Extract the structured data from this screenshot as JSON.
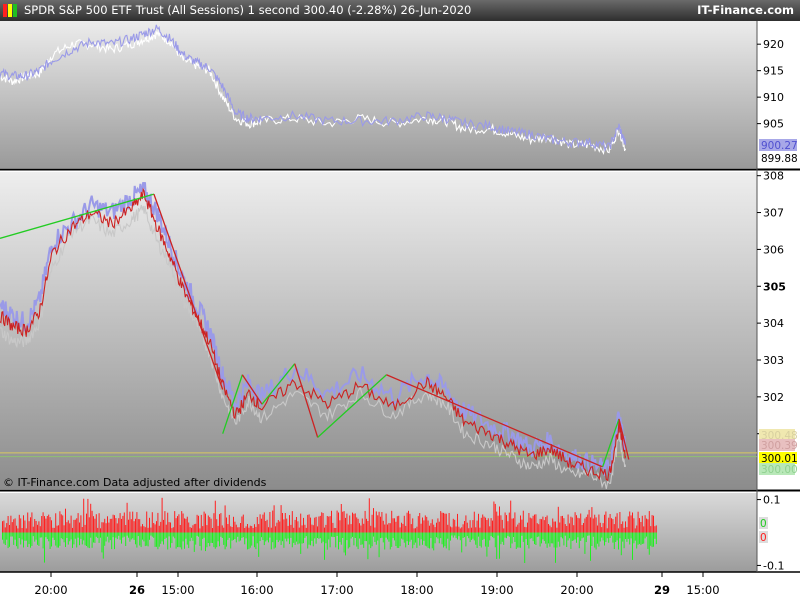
{
  "header": {
    "title": "SPDR S&P 500 ETF Trust (All Sessions)   1 second   300.40 (-2.28%)   26-Jun-2020",
    "brand": "IT-Finance.com",
    "logo_colors": [
      "#ff2020",
      "#ffff00",
      "#20c020"
    ]
  },
  "chart_data": [
    {
      "type": "line",
      "panel": "top",
      "y_ticks": [
        "920",
        "915",
        "910",
        "905"
      ],
      "ylim": [
        897,
        924
      ],
      "series": [
        {
          "color": "#ffffff",
          "x": [
            19.5,
            19.7,
            19.9,
            20.1,
            20.3,
            20.6,
            20.9,
            21.2,
            21.5,
            21.7,
            21.9,
            22.1,
            22.3,
            22.5,
            22.7,
            22.9,
            23.1,
            23.3,
            23.5,
            24.0,
            24.5,
            25.0,
            25.5,
            26.0,
            26.3,
            26.6,
            27.0,
            27.3,
            27.6,
            27.9,
            28.2,
            28.5,
            28.8,
            28.95,
            29.05
          ],
          "y": [
            914,
            913,
            914,
            914.5,
            918,
            920,
            920,
            919,
            920,
            921,
            922,
            920.5,
            917,
            916,
            915,
            910,
            906,
            905,
            905.5,
            906,
            905,
            906,
            905,
            906,
            905.5,
            904,
            904,
            903,
            902,
            902.5,
            901,
            901,
            900,
            904,
            900
          ]
        },
        {
          "color": "#9a9ae8",
          "x": [
            19.5,
            19.7,
            19.9,
            20.1,
            20.3,
            20.6,
            20.9,
            21.2,
            21.5,
            21.7,
            21.9,
            22.1,
            22.3,
            22.5,
            22.7,
            22.9,
            23.1,
            23.3,
            23.5,
            24.0,
            24.5,
            25.0,
            25.5,
            26.0,
            26.3,
            26.6,
            27.0,
            27.3,
            27.6,
            27.9,
            28.2,
            28.5,
            28.8,
            28.95,
            29.05
          ],
          "y": [
            914.5,
            914,
            914,
            915,
            917,
            919,
            920.5,
            920,
            921,
            922,
            923,
            921,
            918,
            916.5,
            915.5,
            912,
            907,
            906,
            906,
            906.5,
            905.5,
            905.5,
            905.5,
            906.5,
            906,
            905,
            904.5,
            903.5,
            903,
            902,
            901.5,
            901.5,
            900.5,
            904.5,
            901
          ]
        }
      ],
      "price_flags": [
        {
          "value": "900.27",
          "bg": "#a8a8e8",
          "fg": "#5050d0"
        },
        {
          "value": "899.88",
          "bg": "#ffffff",
          "fg": "#000000"
        }
      ]
    },
    {
      "type": "line",
      "panel": "main",
      "y_ticks": [
        "308",
        "307",
        "306",
        "305",
        "304",
        "303",
        "302",
        "301"
      ],
      "bold_tick": "305",
      "ylim": [
        299.5,
        308.1
      ],
      "x_start": "20:00",
      "x_end": "29 15:00",
      "series": [
        {
          "name": "",
          "color": "#9a9ae8",
          "x": [
            19.5,
            19.7,
            19.9,
            20.1,
            20.3,
            20.6,
            20.9,
            21.2,
            21.5,
            21.7,
            21.9,
            22.1,
            22.3,
            22.5,
            22.7,
            22.9,
            23.1,
            23.3,
            23.5,
            24.0,
            24.5,
            25.0,
            25.5,
            26.0,
            26.3,
            26.6,
            27.0,
            27.3,
            27.6,
            27.9,
            28.2,
            28.5,
            28.8,
            28.95,
            29.05
          ],
          "y": [
            304.5,
            304.2,
            304.0,
            304.6,
            306.2,
            306.7,
            307.2,
            307.0,
            307.4,
            307.6,
            307.0,
            306.1,
            305.2,
            304.5,
            303.8,
            302.6,
            301.8,
            302.4,
            302.0,
            302.8,
            302.1,
            302.6,
            302.0,
            302.6,
            302.2,
            301.6,
            301.2,
            301.0,
            300.6,
            300.8,
            300.4,
            300.2,
            300.0,
            301.5,
            300.6
          ]
        },
        {
          "name": "",
          "color": "#c8c8c8",
          "x": [
            19.5,
            19.7,
            19.9,
            20.1,
            20.3,
            20.6,
            20.9,
            21.2,
            21.5,
            21.7,
            21.9,
            22.1,
            22.3,
            22.5,
            22.7,
            22.9,
            23.1,
            23.3,
            23.5,
            24.0,
            24.5,
            25.0,
            25.5,
            26.0,
            26.3,
            26.6,
            27.0,
            27.3,
            27.6,
            27.9,
            28.2,
            28.5,
            28.8,
            28.95,
            29.05
          ],
          "y": [
            303.8,
            303.5,
            303.5,
            304.0,
            305.5,
            306.5,
            306.8,
            306.4,
            306.8,
            307.1,
            306.2,
            305.6,
            304.6,
            304.0,
            303.2,
            302.0,
            301.3,
            301.9,
            301.4,
            302.1,
            301.5,
            302.1,
            301.5,
            302.1,
            301.8,
            301.0,
            300.7,
            300.4,
            300.1,
            300.3,
            299.9,
            299.9,
            299.6,
            300.9,
            300.1
          ]
        },
        {
          "name": "",
          "color": "#cc2222",
          "x": [
            19.5,
            19.7,
            19.9,
            20.1,
            20.3,
            20.6,
            20.9,
            21.2,
            21.5,
            21.7,
            21.9,
            22.1,
            22.3,
            22.5,
            22.7,
            22.9,
            23.1,
            23.3,
            23.5,
            24.0,
            24.5,
            25.0,
            25.5,
            26.0,
            26.3,
            26.6,
            27.0,
            27.3,
            27.6,
            27.9,
            28.2,
            28.5,
            28.8,
            28.95,
            29.05
          ],
          "y": [
            304.2,
            303.9,
            303.8,
            304.3,
            305.9,
            306.6,
            307.0,
            306.7,
            307.1,
            307.5,
            306.6,
            305.8,
            304.9,
            304.2,
            303.5,
            302.3,
            301.5,
            302.1,
            301.7,
            302.4,
            301.8,
            302.3,
            301.7,
            302.4,
            302.0,
            301.3,
            301.0,
            300.7,
            300.4,
            300.6,
            300.2,
            300.0,
            299.9,
            301.2,
            300.4
          ]
        }
      ],
      "trend_segments": [
        {
          "color": "#22cc22",
          "x": [
            19.5,
            21.85
          ],
          "y": [
            306.3,
            307.5
          ]
        },
        {
          "color": "#cc2222",
          "x": [
            21.85,
            22.9
          ],
          "y": [
            307.5,
            302.2
          ]
        },
        {
          "color": "#22cc22",
          "x": [
            22.9,
            23.2
          ],
          "y": [
            301.0,
            302.6
          ]
        },
        {
          "color": "#cc2222",
          "x": [
            23.2,
            23.5
          ],
          "y": [
            302.6,
            301.8
          ]
        },
        {
          "color": "#22cc22",
          "x": [
            23.5,
            24.0
          ],
          "y": [
            301.8,
            302.9
          ]
        },
        {
          "color": "#cc2222",
          "x": [
            24.0,
            24.35
          ],
          "y": [
            302.9,
            300.9
          ]
        },
        {
          "color": "#22cc22",
          "x": [
            24.35,
            25.4
          ],
          "y": [
            300.9,
            302.6
          ]
        },
        {
          "color": "#cc2222",
          "x": [
            25.4,
            28.7
          ],
          "y": [
            302.6,
            300.1
          ]
        },
        {
          "color": "#22cc22",
          "x": [
            28.7,
            28.95
          ],
          "y": [
            300.1,
            301.4
          ]
        },
        {
          "color": "#cc2222",
          "x": [
            28.95,
            29.1
          ],
          "y": [
            301.4,
            300.3
          ]
        }
      ],
      "h_lines": [
        {
          "value": 300.48,
          "color": "#d8c860"
        },
        {
          "value": 300.38,
          "color": "#90c070"
        }
      ],
      "price_flags": [
        {
          "value": "300.48",
          "bg": "#f0e8b0",
          "fg": "#d8d0a0"
        },
        {
          "value": "300.39",
          "bg": "#e8c0c0",
          "fg": "#d0a0a0"
        },
        {
          "value": "300.01",
          "bg": "#ffff00",
          "fg": "#000000"
        },
        {
          "value": "300.00",
          "bg": "#b8e8b8",
          "fg": "#90d090"
        }
      ],
      "annotation": "© IT-Finance.com  Data adjusted after dividends"
    },
    {
      "type": "bar",
      "panel": "volume",
      "y_ticks": [
        "0.1",
        "0",
        "0",
        "-0.1"
      ],
      "ylim": [
        -0.12,
        0.12
      ],
      "up_color": "#ff2020",
      "down_color": "#22ee22",
      "flag_colors": [
        "#22cc22",
        "#ff2020"
      ]
    },
    {
      "type": "axis",
      "x_tick_labels": [
        "20:00",
        "26",
        "15:00",
        "16:00",
        "17:00",
        "18:00",
        "19:00",
        "20:00",
        "29",
        "15:00"
      ],
      "bold_labels": [
        "26",
        "29"
      ]
    }
  ]
}
